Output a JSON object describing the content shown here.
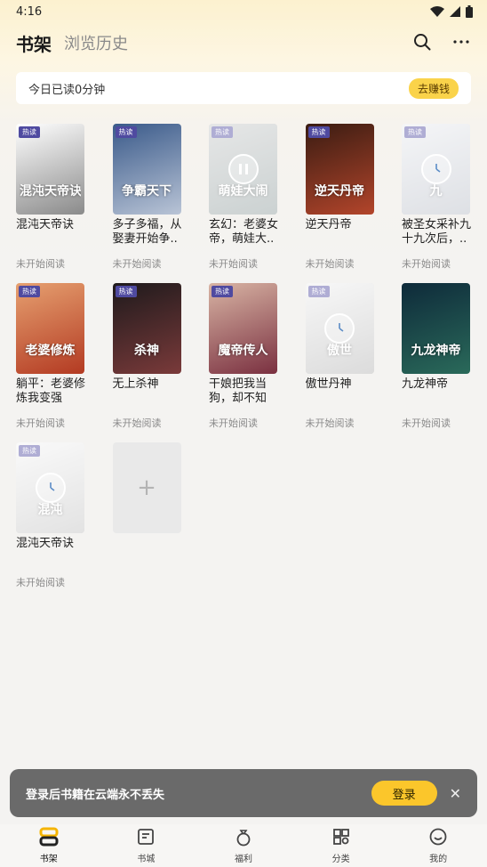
{
  "status": {
    "time": "4:16"
  },
  "header": {
    "tab_shelf": "书架",
    "tab_history": "浏览历史"
  },
  "read_bar": {
    "text": "今日已读0分钟",
    "earn_label": "去赚钱"
  },
  "books": [
    {
      "title": "混沌天帝诀",
      "status": "未开始阅读",
      "badge": "热读",
      "cover_title": "混沌天帝诀",
      "colors": [
        "#ffffff",
        "#8a8a8a"
      ],
      "state": "none"
    },
    {
      "title": "多子多福，从娶妻开始争..",
      "status": "未开始阅读",
      "badge": "热读",
      "cover_title": "争霸天下",
      "colors": [
        "#3a5a8a",
        "#b9c4d6"
      ],
      "state": "none"
    },
    {
      "title": "玄幻：老婆女帝，萌娃大..",
      "status": "未开始阅读",
      "badge": "热读",
      "cover_title": "萌娃大闹",
      "colors": [
        "#c7c9c9",
        "#8c9a9a"
      ],
      "state": "paused"
    },
    {
      "title": "逆天丹帝",
      "status": "未开始阅读",
      "badge": "热读",
      "cover_title": "逆天丹帝",
      "colors": [
        "#3a1c12",
        "#b3452b"
      ],
      "state": "none"
    },
    {
      "title": "被圣女采补九十九次后，..",
      "status": "未开始阅读",
      "badge": "热读",
      "cover_title": "九",
      "colors": [
        "#e8eaee",
        "#b5bac4"
      ],
      "state": "waiting"
    },
    {
      "title": "躺平：老婆修炼我变强",
      "status": "未开始阅读",
      "badge": "热读",
      "cover_title": "老婆修炼",
      "colors": [
        "#e6a070",
        "#b33a22"
      ],
      "state": "none"
    },
    {
      "title": "无上杀神",
      "status": "未开始阅读",
      "badge": "热读",
      "cover_title": "杀神",
      "colors": [
        "#1e1a1c",
        "#7a3a3a"
      ],
      "state": "none"
    },
    {
      "title": "干娘把我当狗，却不知我..",
      "status": "未开始阅读",
      "badge": "热读",
      "cover_title": "魔帝传人",
      "colors": [
        "#d8b4a4",
        "#7a3040"
      ],
      "state": "none"
    },
    {
      "title": "傲世丹神",
      "status": "未开始阅读",
      "badge": "热读",
      "cover_title": "傲世",
      "colors": [
        "#eeeeee",
        "#b0b0b0"
      ],
      "state": "waiting"
    },
    {
      "title": "九龙神帝",
      "status": "未开始阅读",
      "badge": "",
      "cover_title": "九龙神帝",
      "colors": [
        "#0e2a3a",
        "#2a6a5a"
      ],
      "state": "none"
    },
    {
      "title": "混沌天帝诀",
      "status": "未开始阅读",
      "badge": "热读",
      "cover_title": "混沌",
      "colors": [
        "#f3f3f3",
        "#c0c0c0"
      ],
      "state": "waiting"
    }
  ],
  "add_label": "+",
  "login_bar": {
    "text": "登录后书籍在云端永不丢失",
    "button": "登录",
    "close": "✕"
  },
  "nav": [
    {
      "label": "书架",
      "icon": "bookshelf-icon",
      "active": true
    },
    {
      "label": "书城",
      "icon": "book-store-icon",
      "active": false
    },
    {
      "label": "福利",
      "icon": "welfare-bag-icon",
      "active": false
    },
    {
      "label": "分类",
      "icon": "category-grid-icon",
      "active": false
    },
    {
      "label": "我的",
      "icon": "profile-icon",
      "active": false
    }
  ]
}
